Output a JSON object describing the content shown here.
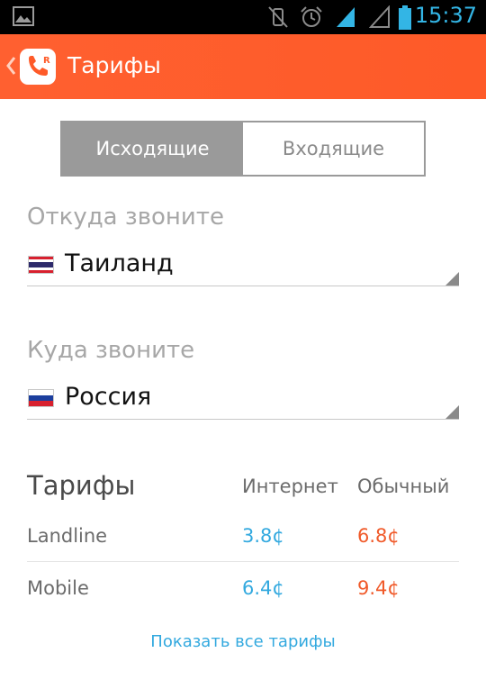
{
  "status_bar": {
    "time": "15:37",
    "icons": [
      "picture-icon",
      "vibrate-mute-icon",
      "alarm-icon",
      "signal-icon",
      "signal-empty-icon",
      "battery-icon"
    ],
    "accent": "#33b5e5"
  },
  "app_bar": {
    "title": "Тарифы",
    "color": "#fe5a28",
    "logo_letter": "R"
  },
  "tabs": [
    {
      "label": "Исходящие",
      "active": true
    },
    {
      "label": "Входящие",
      "active": false
    }
  ],
  "from": {
    "label": "Откуда звоните",
    "country": "Таиланд",
    "flag": "thailand-flag-icon"
  },
  "to": {
    "label": "Куда звоните",
    "country": "Россия",
    "flag": "russia-flag-icon"
  },
  "rates": {
    "title": "Тарифы",
    "columns": [
      "Интернет",
      "Обычный"
    ],
    "rows": [
      {
        "label": "Landline",
        "internet": "3.8¢",
        "regular": "6.8¢"
      },
      {
        "label": "Mobile",
        "internet": "6.4¢",
        "regular": "9.4¢"
      }
    ],
    "internet_color": "#33a9df",
    "regular_color": "#f05a2a"
  },
  "show_all_link": "Показать все тарифы"
}
